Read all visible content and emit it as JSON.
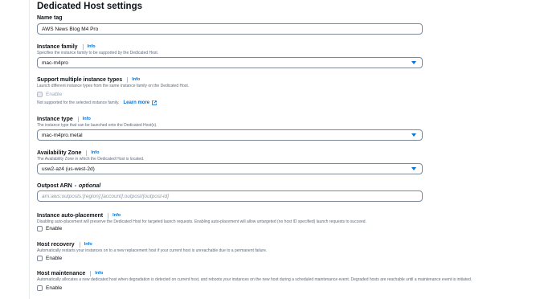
{
  "section_title": "Dedicated Host settings",
  "info_label": "Info",
  "name_tag": {
    "label": "Name tag",
    "value": "AWS News Blog M4 Pro"
  },
  "instance_family": {
    "label": "Instance family",
    "description": "Specifies the instance family to be supported by the Dedicated Host.",
    "value": "mac-m4pro"
  },
  "multiple_instance_types": {
    "label": "Support multiple instance types",
    "description": "Launch different instance types from the same instance family on the Dedicated Host.",
    "checkbox_label": "Enable",
    "note": "Not supported for the selected instance family.",
    "learn_more": "Learn more"
  },
  "instance_type": {
    "label": "Instance type",
    "description": "The instance type that can be launched onto the Dedicated Host(s).",
    "value": "mac-m4pro.metal"
  },
  "availability_zone": {
    "label": "Availability Zone",
    "description": "The Availability Zone in which the Dedicated Host is located.",
    "value": "usw2-az4 (us-west-2d)"
  },
  "outpost_arn": {
    "label": "Outpost ARN",
    "optional": "optional",
    "placeholder": "arn:aws:outposts:[region]:[account]:outpost/[outpost-id]"
  },
  "instance_auto_placement": {
    "label": "Instance auto-placement",
    "description": "Disabling auto-placement will preserve the Dedicated Host for targeted launch requests. Enabling auto-placement will allow untargeted (no host ID specified) launch requests to succeed.",
    "checkbox_label": "Enable"
  },
  "host_recovery": {
    "label": "Host recovery",
    "description": "Automatically restarts your instances on to a new replacement host if your current host is unreachable due to a permanent failure.",
    "checkbox_label": "Enable"
  },
  "host_maintenance": {
    "label": "Host maintenance",
    "description": "Automatically allocates a new dedicated host when degradation is detected on current host, and reboots your instances on the new host during a scheduled maintenance event. Degraded hosts are reachable until a maintenance event is initiated.",
    "checkbox_label": "Enable"
  },
  "colors": {
    "link": "#0972d3",
    "text": "#0f141a",
    "muted": "#5f6b7a",
    "border": "#7d8998"
  }
}
